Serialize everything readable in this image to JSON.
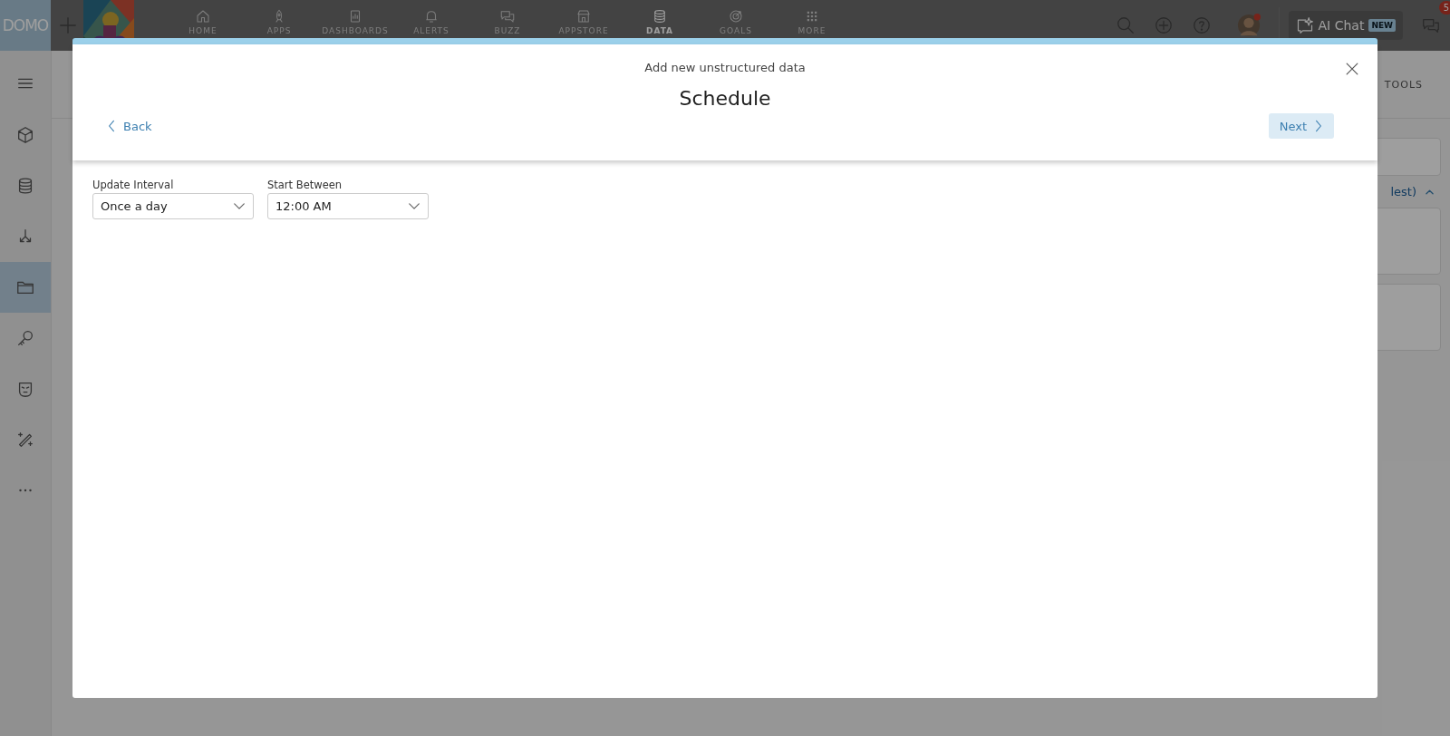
{
  "topbar": {
    "logo": "DOMO",
    "nav": [
      {
        "label": "HOME",
        "kind": "home",
        "selected": false
      },
      {
        "label": "APPS",
        "kind": "rocket",
        "selected": false
      },
      {
        "label": "DASHBOARDS",
        "kind": "pages",
        "selected": false
      },
      {
        "label": "ALERTS",
        "kind": "bell",
        "selected": false
      },
      {
        "label": "BUZZ",
        "kind": "chat",
        "selected": false
      },
      {
        "label": "APPSTORE",
        "kind": "store",
        "selected": false
      },
      {
        "label": "DATA",
        "kind": "database",
        "selected": true
      },
      {
        "label": "GOALS",
        "kind": "target",
        "selected": false
      },
      {
        "label": "MORE",
        "kind": "grid",
        "selected": false
      }
    ],
    "ai_chat": {
      "label": "AI Chat",
      "badge": "NEW"
    },
    "messages_count": "5"
  },
  "sidebar": {
    "items": [
      {
        "kind": "cube",
        "selected": false
      },
      {
        "kind": "database",
        "selected": false
      },
      {
        "kind": "split",
        "selected": false
      },
      {
        "kind": "folder",
        "selected": true
      },
      {
        "kind": "key",
        "selected": false
      },
      {
        "kind": "mask",
        "selected": false
      },
      {
        "kind": "wand",
        "selected": false
      },
      {
        "kind": "more",
        "selected": false
      }
    ]
  },
  "background": {
    "tab": "TOOLS",
    "sort_label": "lest)"
  },
  "modal": {
    "subtitle": "Add new unstructured data",
    "title": "Schedule",
    "back": "Back",
    "next": "Next",
    "fields": [
      {
        "label": "Update Interval",
        "value": "Once a day"
      },
      {
        "label": "Start Between",
        "value": "12:00 AM"
      }
    ]
  }
}
